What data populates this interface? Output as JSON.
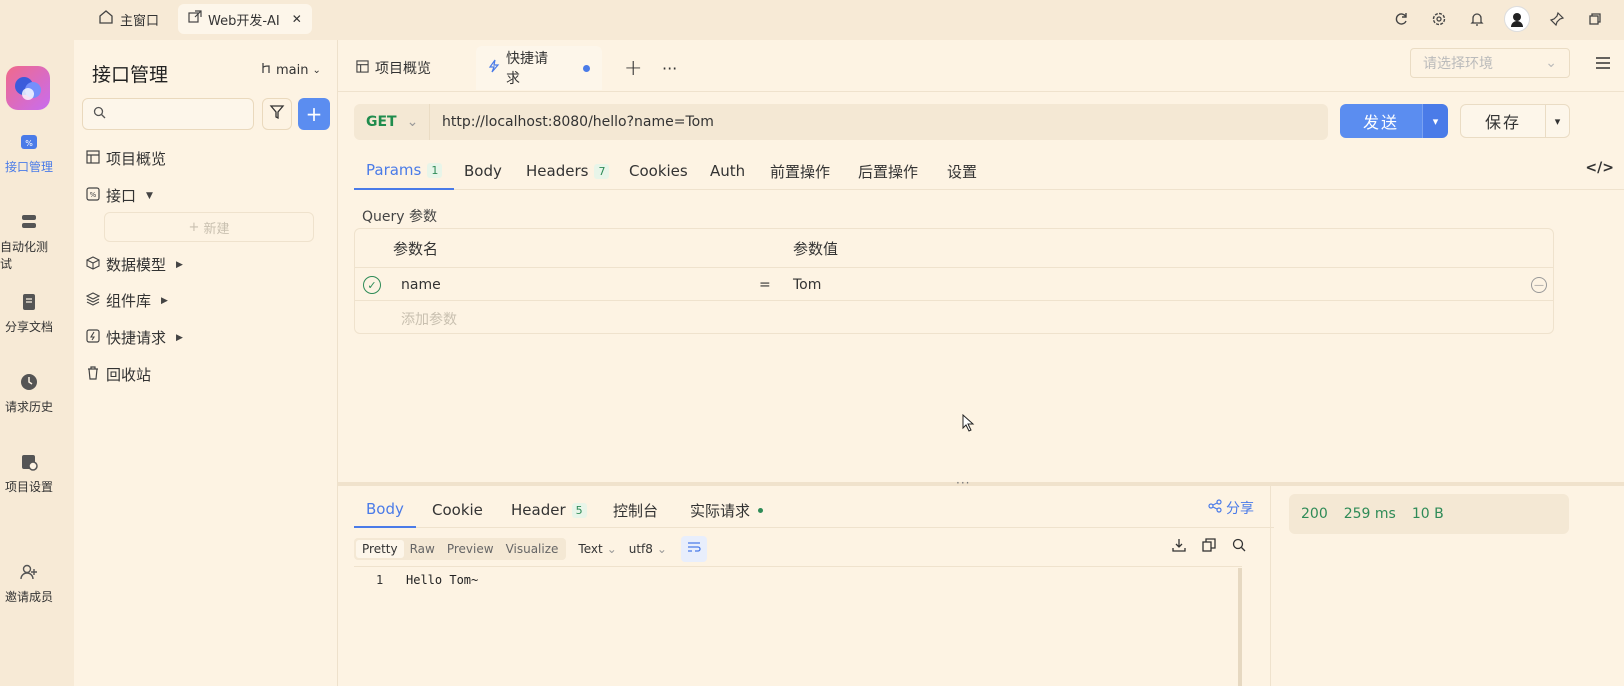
{
  "titlebar": {
    "tabs": [
      {
        "label": "主窗口",
        "icon": "home-icon"
      },
      {
        "label": "Web开发-AI",
        "icon": "external-window-icon"
      }
    ],
    "right_icons": [
      "refresh-icon",
      "gear-icon",
      "bell-icon",
      "avatar",
      "pin-icon",
      "restore-icon"
    ]
  },
  "rail": {
    "items": [
      {
        "label": "接口管理",
        "icon": "api-icon",
        "active": true
      },
      {
        "label": "自动化测试",
        "icon": "automation-icon"
      },
      {
        "label": "分享文档",
        "icon": "share-doc-icon"
      },
      {
        "label": "请求历史",
        "icon": "history-icon"
      },
      {
        "label": "项目设置",
        "icon": "project-settings-icon"
      },
      {
        "label": "邀请成员",
        "icon": "invite-member-icon"
      }
    ]
  },
  "sidebar": {
    "title": "接口管理",
    "branch": "main",
    "search_placeholder": "",
    "items": [
      {
        "label": "项目概览",
        "icon": "overview-icon"
      },
      {
        "label": "接口",
        "icon": "api-folder-icon",
        "has_caret": true
      },
      {
        "label": "数据模型",
        "icon": "cube-icon",
        "has_caret": true
      },
      {
        "label": "组件库",
        "icon": "layers-icon",
        "has_caret": true
      },
      {
        "label": "快捷请求",
        "icon": "lightning-icon",
        "has_caret": true
      },
      {
        "label": "回收站",
        "icon": "trash-icon"
      }
    ],
    "new_label": "新建"
  },
  "main": {
    "tabs": [
      {
        "label": "项目概览"
      },
      {
        "label": "快捷请求",
        "active": true,
        "unsaved": true
      }
    ],
    "env_placeholder": "请选择环境",
    "request": {
      "method": "GET",
      "url": "http://localhost:8080/hello?name=Tom",
      "send_label": "发送",
      "save_label": "保存"
    },
    "req_tabs": [
      {
        "label": "Params",
        "badge": "1",
        "active": true
      },
      {
        "label": "Body"
      },
      {
        "label": "Headers",
        "badge": "7"
      },
      {
        "label": "Cookies"
      },
      {
        "label": "Auth"
      },
      {
        "label": "前置操作"
      },
      {
        "label": "后置操作"
      },
      {
        "label": "设置"
      }
    ],
    "query": {
      "label": "Query 参数",
      "col_name": "参数名",
      "col_value": "参数值",
      "rows": [
        {
          "name": "name",
          "eq": "=",
          "value": "Tom",
          "enabled": true
        }
      ],
      "add_placeholder": "添加参数"
    },
    "resp_tabs": [
      {
        "label": "Body",
        "active": true
      },
      {
        "label": "Cookie"
      },
      {
        "label": "Header",
        "badge": "5"
      },
      {
        "label": "控制台"
      },
      {
        "label": "实际请求",
        "dot": true
      }
    ],
    "share_label": "分享",
    "format_modes": [
      "Pretty",
      "Raw",
      "Preview",
      "Visualize"
    ],
    "format_active": "Pretty",
    "content_type": "Text",
    "encoding": "utf8",
    "response_body": [
      {
        "line": "1",
        "text": "Hello Tom~"
      }
    ],
    "status": {
      "code": "200",
      "time": "259 ms",
      "size": "10 B"
    }
  }
}
